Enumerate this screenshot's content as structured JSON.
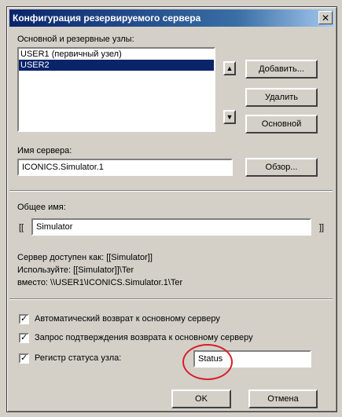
{
  "title": "Конфигурация резервируемого сервера",
  "close_glyph": "✕",
  "nodes": {
    "label": "Основной и резервные узлы:",
    "items": [
      "USER1  (первичный узел)",
      "USER2"
    ],
    "selected_index": 1,
    "scroll_up_glyph": "▲",
    "scroll_down_glyph": "▼"
  },
  "buttons": {
    "add": "Добавить...",
    "remove": "Удалить",
    "primary": "Основной",
    "browse": "Обзор...",
    "ok": "OK",
    "cancel": "Отмена"
  },
  "server_name": {
    "label": "Имя сервера:",
    "value": "ICONICS.Simulator.1"
  },
  "common_name": {
    "label": "Общее имя:",
    "left_bracket": "[[",
    "right_bracket": "]]",
    "value": "Simulator"
  },
  "info": {
    "line1": "Сервер доступен как: [[Simulator]]",
    "line2": "Используйте: [[Simulator]]\\Ter",
    "line3": "вместо: \\\\USER1\\ICONICS.Simulator.1\\Ter"
  },
  "options": {
    "auto_return": "Автоматический возврат к основному серверу",
    "confirm_return": "Запрос подтверждения возврата к основному серверу",
    "status_register": "Регистр статуса узла:",
    "status_value": "Status",
    "check_glyph": "✓"
  },
  "colors": {
    "titlebar": "#0a246a",
    "selection": "#0a246a",
    "highlight_circle": "#d4202a"
  }
}
